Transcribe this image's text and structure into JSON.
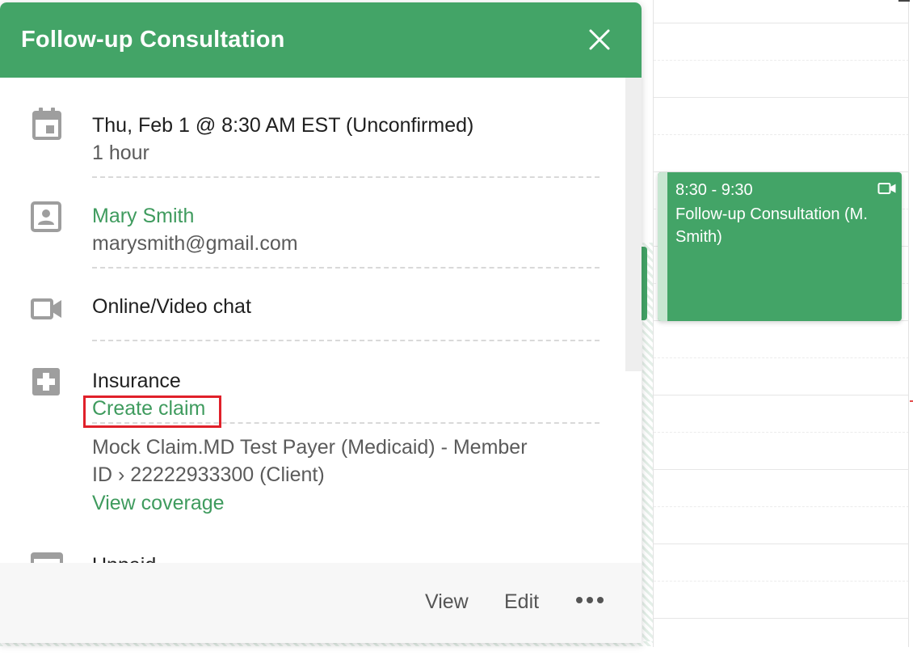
{
  "popup": {
    "title": "Follow-up Consultation",
    "close_icon": "close-icon",
    "datetime": {
      "icon": "calendar-icon",
      "primary": "Thu, Feb 1 @ 8:30 AM EST (Unconfirmed)",
      "duration": "1 hour"
    },
    "client": {
      "icon": "contact-card-icon",
      "name": "Mary Smith",
      "email": "marysmith@gmail.com"
    },
    "location": {
      "icon": "video-camera-icon",
      "label": "Online/Video chat"
    },
    "insurance": {
      "icon": "medical-plus-icon",
      "label": "Insurance",
      "create_claim": "Create claim",
      "payer_line1": "Mock Claim.MD Test Payer (Medicaid) - Member",
      "payer_line2": "ID › 22222933300 (Client)",
      "view_coverage": "View coverage"
    },
    "billing": {
      "icon": "credit-card-icon",
      "label": "Unpaid"
    },
    "footer": {
      "view": "View",
      "edit": "Edit",
      "more_icon": "more-horizontal-icon"
    }
  },
  "calendar_event": {
    "time": "8:30 - 9:30",
    "title": "Follow-up Consultation (M. Smith)",
    "icon": "video-camera-icon"
  },
  "colors": {
    "brand_green": "#43a467",
    "link_green": "#3f9b5e",
    "highlight_red": "#e0202a"
  }
}
